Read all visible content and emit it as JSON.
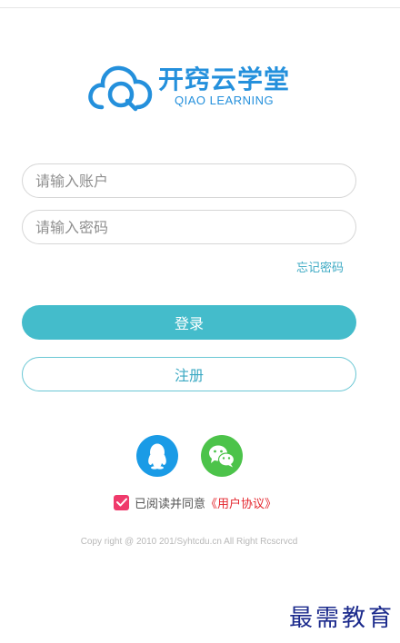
{
  "logo": {
    "name_cn": "开窍云学堂",
    "name_en": "QIAO LEARNING",
    "icon": "cloud-q-logo-icon",
    "color": "#2490dc"
  },
  "form": {
    "account_placeholder": "请输入账户",
    "password_placeholder": "请输入密码",
    "forgot_label": "忘记密码",
    "login_label": "登录",
    "register_label": "注册"
  },
  "social": {
    "qq_icon": "qq-penguin-icon",
    "wechat_icon": "wechat-icon"
  },
  "agreement": {
    "checked": true,
    "text": "已阅读并同意",
    "link": "《用户协议》"
  },
  "footer": {
    "copyright": "Copy right @ 2010 201/Syhtcdu.cn All Right Rcscrvcd"
  },
  "watermark": "最需教育",
  "colors": {
    "accent": "#44bccb",
    "link": "#3ba9c3",
    "qq": "#1a9be6",
    "wechat": "#4cc34a",
    "checkbox": "#ef3a6b",
    "agreement_link": "#e4262d"
  }
}
